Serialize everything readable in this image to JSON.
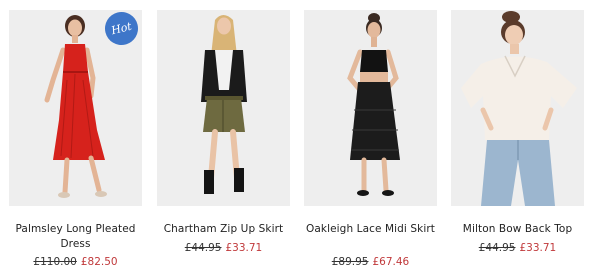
{
  "products": [
    {
      "name": "Palmsley Long Pleated Dress",
      "old_price": "£110.00",
      "new_price": "£82.50",
      "badge": "Hot",
      "photo_icon": "model-red-dress"
    },
    {
      "name": "Chartham Zip Up Skirt",
      "old_price": "£44.95",
      "new_price": "£33.71",
      "photo_icon": "model-khaki-skirt"
    },
    {
      "name": "Oakleigh Lace Midi Skirt",
      "old_price": "£89.95",
      "new_price": "£67.46",
      "photo_icon": "model-black-lace-skirt"
    },
    {
      "name": "Milton Bow Back Top",
      "old_price": "£44.95",
      "new_price": "£33.71",
      "photo_icon": "model-white-top"
    }
  ],
  "colors": {
    "badge": "#3e76c9",
    "sale_price": "#c0393b",
    "photo_background": "#eeeeee"
  }
}
